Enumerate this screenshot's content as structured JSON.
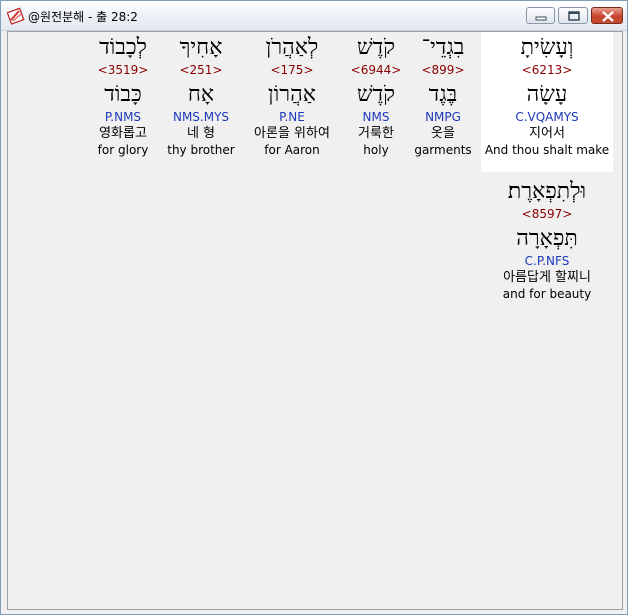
{
  "window": {
    "title": "@원전분해 - 출 28:2",
    "controls": {
      "minimize": "minimize",
      "maximize": "maximize",
      "close": "close"
    }
  },
  "words": [
    {
      "hebrew": "וְעָשִׂיתָ",
      "strong": "<6213>",
      "lemma": "עָשָׂה",
      "parsing": "C.VQAMYS",
      "korean": "지어서",
      "english": "And thou shalt make",
      "selected": true
    },
    {
      "hebrew": "בִגְדֵי־",
      "strong": "<899>",
      "lemma": "בֶּגֶד",
      "parsing": "NMPG",
      "korean": "옷을",
      "english": "garments",
      "selected": false
    },
    {
      "hebrew": "קֹדֶשׁ",
      "strong": "<6944>",
      "lemma": "קֹדֶשׁ",
      "parsing": "NMS",
      "korean": "거룩한",
      "english": "holy",
      "selected": false
    },
    {
      "hebrew": "לְאַהֲרֹן",
      "strong": "<175>",
      "lemma": "אַהֲרוֹן",
      "parsing": "P.NE",
      "korean": "아론을 위하여",
      "english": "for Aaron",
      "selected": false
    },
    {
      "hebrew": "אָחִיךָ",
      "strong": "<251>",
      "lemma": "אָח",
      "parsing": "NMS.MYS",
      "korean": "네 형",
      "english": "thy brother",
      "selected": false
    },
    {
      "hebrew": "לְכָבוֹד",
      "strong": "<3519>",
      "lemma": "כָּבוֹד",
      "parsing": "P.NMS",
      "korean": "영화롭고",
      "english": "for glory",
      "selected": false
    },
    {
      "hebrew": "וּלְתִפְאָרֶת׃",
      "strong": "<8597>",
      "lemma": "תִּפְאָרָה",
      "parsing": "C.P.NFS",
      "korean": "아름답게 할찌니",
      "english": "and for beauty",
      "selected": false
    }
  ]
}
